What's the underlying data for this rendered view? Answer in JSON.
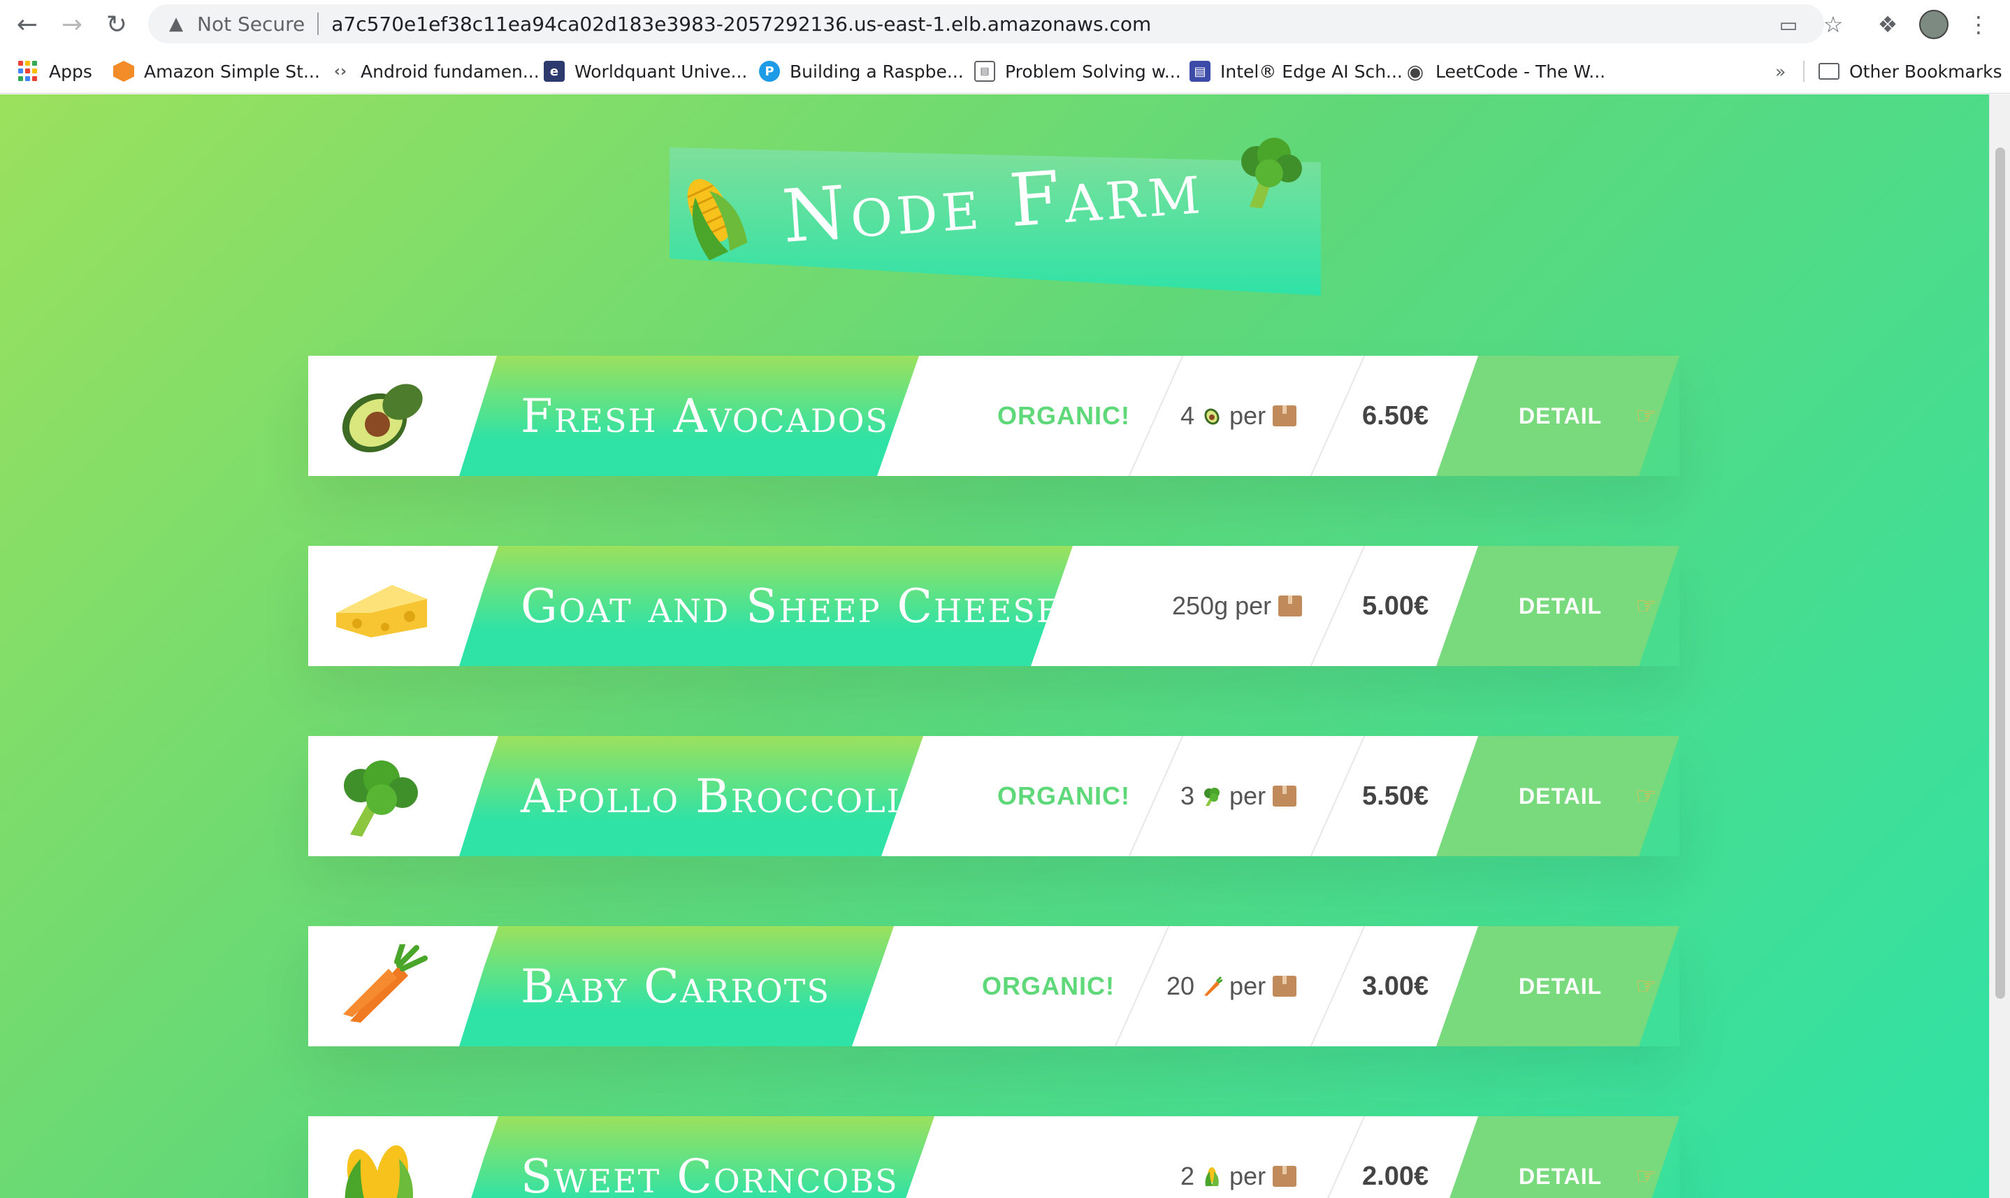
{
  "browser": {
    "address": {
      "security_label": "Not Secure",
      "url": "a7c570e1ef38c11ea94ca02d183e3983-2057292136.us-east-1.elb.amazonaws.com"
    },
    "bookmarks": [
      {
        "label": "Apps",
        "icon": "apps-grid-icon"
      },
      {
        "label": "Amazon Simple St...",
        "icon": "aws-cube-icon"
      },
      {
        "label": "Android fundamen...",
        "icon": "code-brackets-icon"
      },
      {
        "label": "Worldquant Unive...",
        "icon": "worldquant-logo-icon"
      },
      {
        "label": "Building a Raspbe...",
        "icon": "pi-logo-icon"
      },
      {
        "label": "Problem Solving w...",
        "icon": "page-icon"
      },
      {
        "label": "Intel® Edge AI Sch...",
        "icon": "intel-page-icon"
      },
      {
        "label": "LeetCode - The W...",
        "icon": "globe-icon"
      }
    ],
    "overflow_label": "»",
    "other_bookmarks_label": "Other Bookmarks"
  },
  "page": {
    "title": "Node Farm",
    "title_icons": [
      "corn-icon",
      "broccoli-icon"
    ]
  },
  "products": [
    {
      "name": "Fresh Avocados",
      "organic": true,
      "organic_label": "ORGANIC!",
      "qty_num": "4",
      "qty_icon": "avocado-icon",
      "per": "per",
      "price": "6.50€",
      "detail_label": "DETAIL",
      "icon": "avocado-icon"
    },
    {
      "name": "Goat and Sheep Cheese",
      "organic": false,
      "organic_label": "",
      "qty_num": "250g",
      "qty_icon": "",
      "per": "per",
      "price": "5.00€",
      "detail_label": "DETAIL",
      "icon": "cheese-icon"
    },
    {
      "name": "Apollo Broccoli",
      "organic": true,
      "organic_label": "ORGANIC!",
      "qty_num": "3",
      "qty_icon": "broccoli-icon",
      "per": "per",
      "price": "5.50€",
      "detail_label": "DETAIL",
      "icon": "broccoli-icon"
    },
    {
      "name": "Baby Carrots",
      "organic": true,
      "organic_label": "ORGANIC!",
      "qty_num": "20",
      "qty_icon": "carrot-icon",
      "per": "per",
      "price": "3.00€",
      "detail_label": "DETAIL",
      "icon": "carrot-icon"
    },
    {
      "name": "Sweet Corncobs",
      "organic": false,
      "organic_label": "",
      "qty_num": "2",
      "qty_icon": "corn-icon",
      "per": "per",
      "price": "2.00€",
      "detail_label": "DETAIL",
      "icon": "corn-icon"
    }
  ],
  "colors": {
    "organic": "#5fd879",
    "detail_bg": "#79d97d",
    "gradient_start": "#9be15d",
    "gradient_end": "#2fe2a6"
  }
}
